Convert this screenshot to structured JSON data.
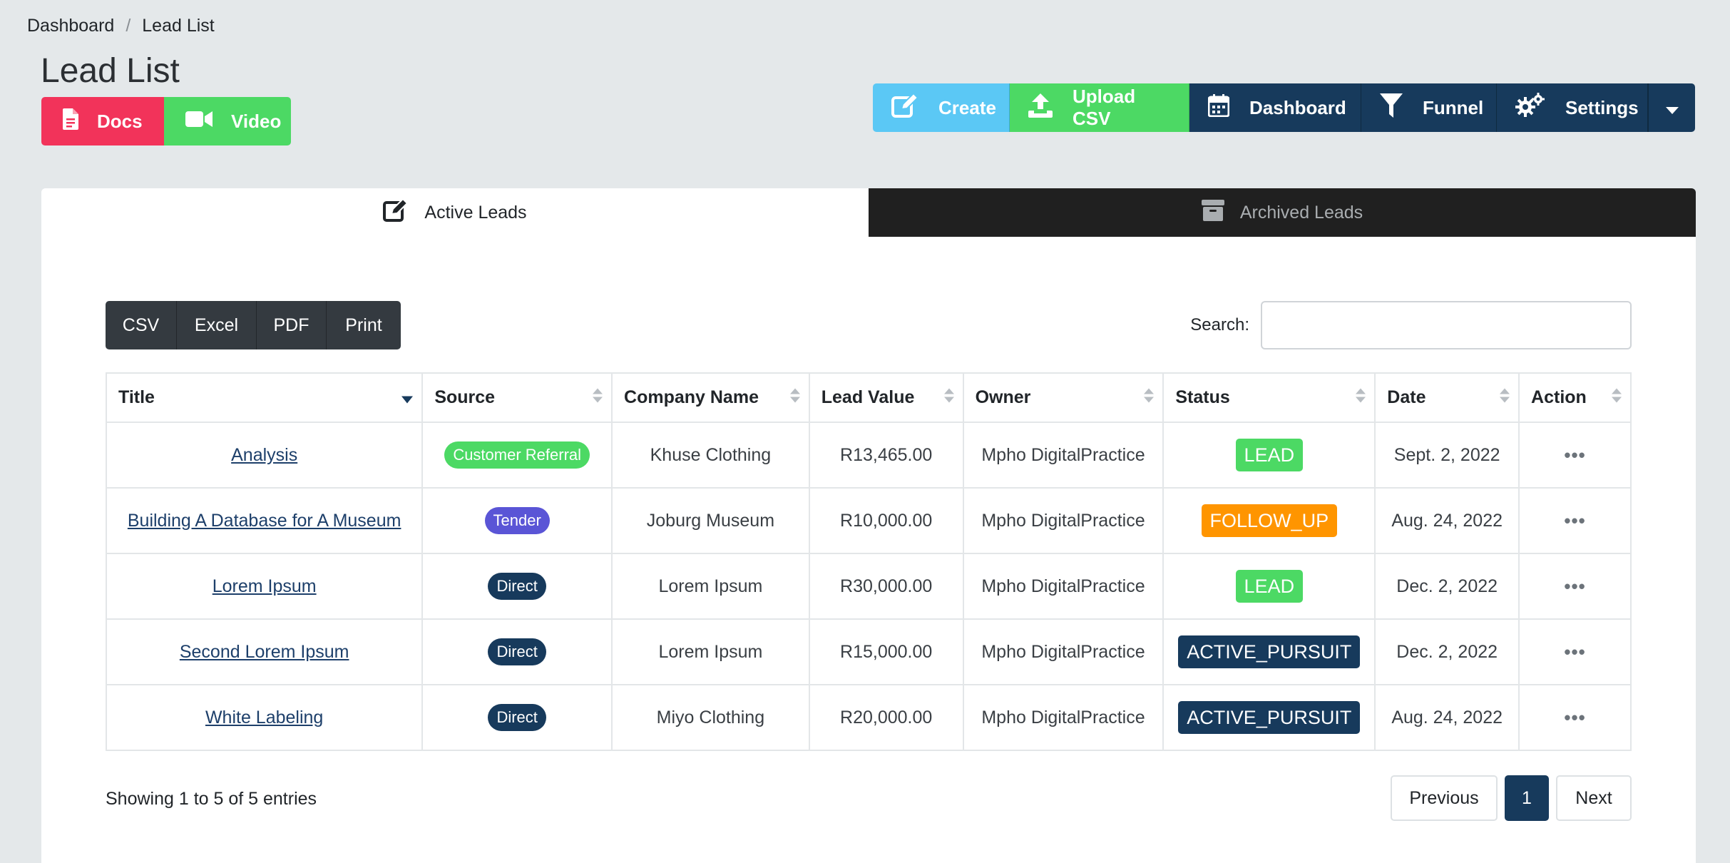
{
  "breadcrumb": {
    "items": [
      "Dashboard",
      "Lead List"
    ],
    "separator": "/"
  },
  "page": {
    "title": "Lead List"
  },
  "doc_buttons": {
    "docs": "Docs",
    "video": "Video"
  },
  "toolbar": {
    "create": "Create",
    "upload": "Upload CSV",
    "dashboard": "Dashboard",
    "funnel": "Funnel",
    "settings": "Settings"
  },
  "tabs": {
    "active": "Active Leads",
    "archived": "Archived Leads"
  },
  "export": {
    "csv": "CSV",
    "excel": "Excel",
    "pdf": "PDF",
    "print": "Print"
  },
  "search": {
    "label": "Search:",
    "value": ""
  },
  "table": {
    "headers": [
      "Title",
      "Source",
      "Company Name",
      "Lead Value",
      "Owner",
      "Status",
      "Date",
      "Action"
    ],
    "rows": [
      {
        "title": "Analysis",
        "source": "Customer Referral",
        "company": "Khuse Clothing",
        "value": "R13,465.00",
        "owner": "Mpho DigitalPractice",
        "status": "LEAD",
        "date": "Sept. 2, 2022"
      },
      {
        "title": "Building A Database for A Museum",
        "source": "Tender",
        "company": "Joburg Museum",
        "value": "R10,000.00",
        "owner": "Mpho DigitalPractice",
        "status": "FOLLOW_UP",
        "date": "Aug. 24, 2022"
      },
      {
        "title": "Lorem Ipsum",
        "source": "Direct",
        "company": "Lorem Ipsum",
        "value": "R30,000.00",
        "owner": "Mpho DigitalPractice",
        "status": "LEAD",
        "date": "Dec. 2, 2022"
      },
      {
        "title": "Second Lorem Ipsum",
        "source": "Direct",
        "company": "Lorem Ipsum",
        "value": "R15,000.00",
        "owner": "Mpho DigitalPractice",
        "status": "ACTIVE_PURSUIT",
        "date": "Dec. 2, 2022"
      },
      {
        "title": "White Labeling",
        "source": "Direct",
        "company": "Miyo Clothing",
        "value": "R20,000.00",
        "owner": "Mpho DigitalPractice",
        "status": "ACTIVE_PURSUIT",
        "date": "Aug. 24, 2022"
      }
    ]
  },
  "footer": {
    "showing": "Showing 1 to 5 of 5 entries"
  },
  "pagination": {
    "prev": "Previous",
    "current": "1",
    "next": "Next"
  },
  "colors": {
    "source": {
      "Customer Referral": "#4cd964",
      "Tender": "#5a55d6",
      "Direct": "#173a5c"
    },
    "status": {
      "LEAD": "#4cd964",
      "FOLLOW_UP": "#ff9500",
      "ACTIVE_PURSUIT": "#173a5c"
    }
  }
}
